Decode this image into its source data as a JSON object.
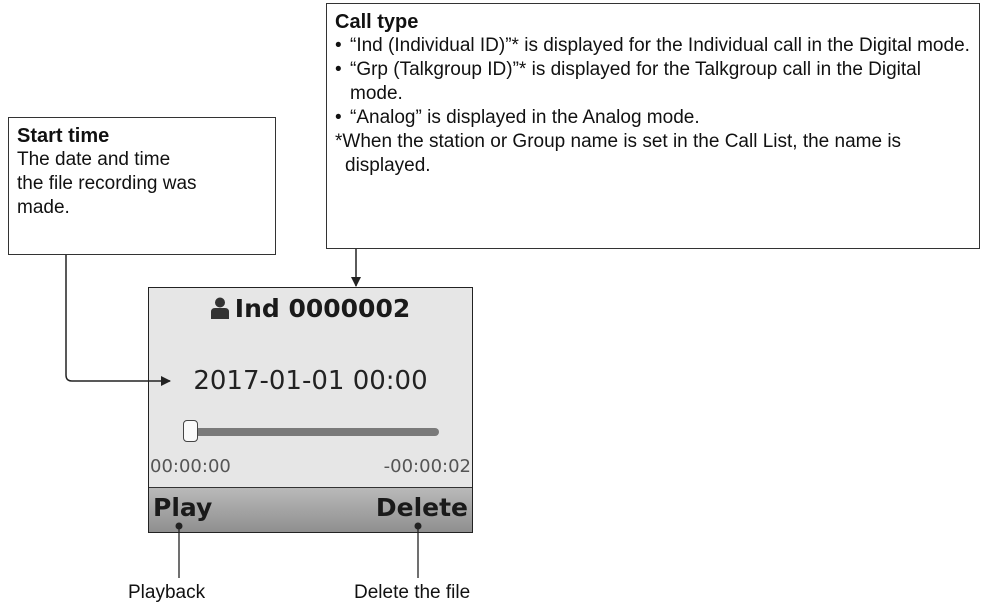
{
  "call_type_box": {
    "title": "Call type",
    "bullets": [
      "“Ind (Individual ID)”* is displayed for the Individual call in the Digital mode.",
      "“Grp (Talkgroup ID)”* is displayed for the Talkgroup call in the Digital mode.",
      "“Analog” is displayed in the Analog mode."
    ],
    "note": "*When the station or Group name is set in the Call List, the name is displayed."
  },
  "start_time_box": {
    "title": "Start time",
    "line1": "The date and time",
    "line2": "the file recording was",
    "line3": "made."
  },
  "screen": {
    "header_icon": "person-icon",
    "header": "Ind 0000002",
    "datetime": "2017-01-01 00:00",
    "progress_fraction": 0.0,
    "elapsed": "00:00:00",
    "remaining": "-00:00:02",
    "softkey_left": "Play",
    "softkey_right": "Delete"
  },
  "labels": {
    "play_desc": "Playback",
    "delete_desc": "Delete the file"
  }
}
